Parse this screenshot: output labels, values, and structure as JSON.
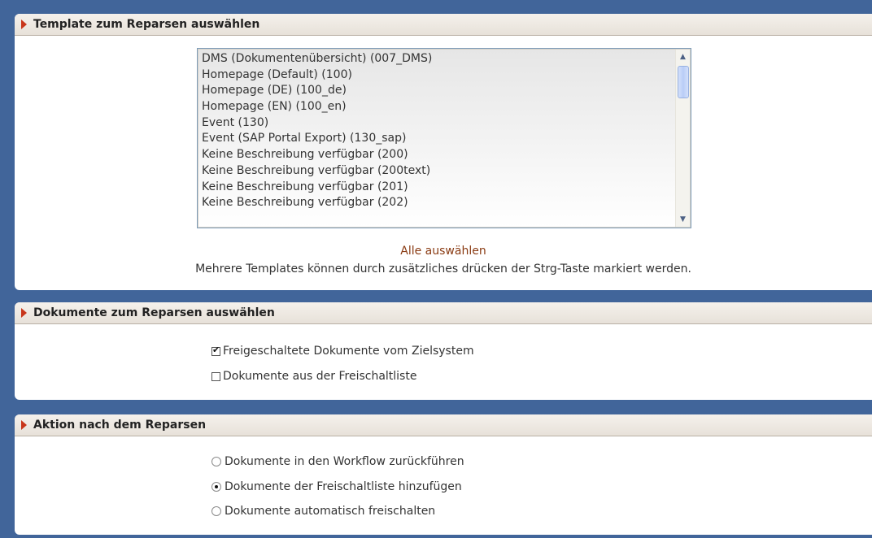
{
  "sections": {
    "template": {
      "title": "Template zum Reparsen auswählen",
      "items": [
        "DMS (Dokumentenübersicht) (007_DMS)",
        "Homepage (Default) (100)",
        "Homepage (DE) (100_de)",
        "Homepage (EN) (100_en)",
        "Event (130)",
        "Event (SAP Portal Export) (130_sap)",
        "Keine Beschreibung verfügbar (200)",
        "Keine Beschreibung verfügbar (200text)",
        "Keine Beschreibung verfügbar (201)",
        "Keine Beschreibung verfügbar (202)"
      ],
      "select_all": "Alle auswählen",
      "hint": "Mehrere Templates können durch zusätzliches drücken der Strg-Taste markiert werden."
    },
    "documents": {
      "title": "Dokumente zum Reparsen auswählen",
      "options": [
        {
          "label": "Freigeschaltete Dokumente vom Zielsystem",
          "checked": true
        },
        {
          "label": "Dokumente aus der Freischaltliste",
          "checked": false
        }
      ]
    },
    "action": {
      "title": "Aktion nach dem Reparsen",
      "options": [
        {
          "label": "Dokumente in den Workflow zurückführen",
          "selected": false
        },
        {
          "label": "Dokumente der Freischaltliste hinzufügen",
          "selected": true
        },
        {
          "label": "Dokumente automatisch freischalten",
          "selected": false
        }
      ]
    }
  },
  "colors": {
    "background": "#41659a",
    "header_arrow": "#c8361b",
    "link": "#8a3b13"
  }
}
